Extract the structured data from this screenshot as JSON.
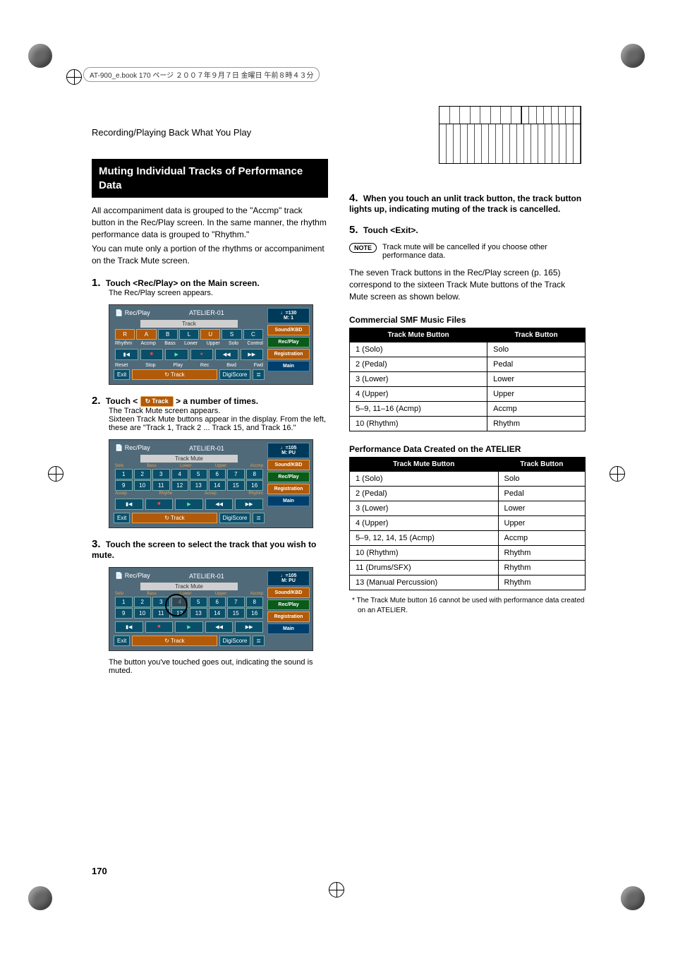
{
  "header_bar": "AT-900_e.book  170 ページ  ２００７年９月７日  金曜日  午前８時４３分",
  "running_head": "Recording/Playing Back What You Play",
  "page_number": "170",
  "section_title": "Muting Individual Tracks of Performance Data",
  "intro_p1": "All accompaniment data is grouped to the \"Accmp\" track button in the Rec/Play screen. In the same manner, the rhythm performance data is grouped to \"Rhythm.\"",
  "intro_p2": "You can mute only a portion of the rhythms or accompaniment on the Track Mute screen.",
  "step1": {
    "num": "1.",
    "instr": "Touch <Rec/Play> on the Main screen.",
    "body": "The Rec/Play screen appears."
  },
  "step2": {
    "num": "2.",
    "prefix": "Touch < ",
    "pill": "Track",
    "suffix": " > a number of times.",
    "body1": "The Track Mute screen appears.",
    "body2": "Sixteen Track Mute buttons appear in the display. From the left, these are \"Track 1, Track 2 ... Track 15, and Track 16.\""
  },
  "step3": {
    "num": "3.",
    "instr": "Touch the screen to select the track that you wish to mute.",
    "caption": "The button you've touched goes out, indicating the sound is muted."
  },
  "step4": {
    "num": "4.",
    "instr": "When you touch an unlit track button, the track button lights up, indicating muting of the track is cancelled."
  },
  "step5": {
    "num": "5.",
    "instr": "Touch <Exit>."
  },
  "note_label": "NOTE",
  "note_text": "Track mute will be cancelled if you choose other performance data.",
  "seven_tracks_p": "The seven Track buttons in the Rec/Play screen (p. 165) correspond to the sixteen Track Mute buttons of the Track Mute screen as shown below.",
  "table1_title": "Commercial SMF Music Files",
  "table_headers": {
    "mute": "Track Mute Button",
    "btn": "Track Button"
  },
  "table1_rows": [
    {
      "mute": "1 (Solo)",
      "btn": "Solo"
    },
    {
      "mute": "2 (Pedal)",
      "btn": "Pedal"
    },
    {
      "mute": "3 (Lower)",
      "btn": "Lower"
    },
    {
      "mute": "4 (Upper)",
      "btn": "Upper"
    },
    {
      "mute": "5–9, 11–16 (Acmp)",
      "btn": "Accmp"
    },
    {
      "mute": "10 (Rhythm)",
      "btn": "Rhythm"
    }
  ],
  "table2_title": "Performance Data Created on the ATELIER",
  "table2_rows": [
    {
      "mute": "1 (Solo)",
      "btn": "Solo"
    },
    {
      "mute": "2 (Pedal)",
      "btn": "Pedal"
    },
    {
      "mute": "3 (Lower)",
      "btn": "Lower"
    },
    {
      "mute": "4 (Upper)",
      "btn": "Upper"
    },
    {
      "mute": "5–9, 12, 14, 15 (Acmp)",
      "btn": "Accmp"
    },
    {
      "mute": "10 (Rhythm)",
      "btn": "Rhythm"
    },
    {
      "mute": "11 (Drums/SFX)",
      "btn": "Rhythm"
    },
    {
      "mute": "13 (Manual Percussion)",
      "btn": "Rhythm"
    }
  ],
  "footnote": "*  The Track Mute button 16 cannot be used with performance data created on an ATELIER.",
  "lcd1": {
    "title_left": "Rec/Play",
    "title_center": "ATELIER-01",
    "tempo": "♩=130",
    "meas": "M:    1",
    "section": "Track",
    "row_labels": [
      "Rhythm",
      "Accmp",
      "Bass",
      "Lower",
      "Upper",
      "",
      "Solo",
      "Control"
    ],
    "btn_letters": [
      "R",
      "A",
      "B",
      "L",
      "U",
      "S",
      "C"
    ],
    "transport": [
      "Reset",
      "Stop",
      "Play",
      "Rec",
      "Bwd",
      "Fwd"
    ],
    "side": [
      "Sound/KBD",
      "Rec/Play",
      "Registration",
      "Main"
    ],
    "footer": [
      "Exit",
      "Track",
      "DigiScore"
    ]
  },
  "lcd2": {
    "title_left": "Rec/Play",
    "title_center": "ATELIER-01",
    "tempo": "♩=105",
    "meas": "M: PU",
    "section": "Track Mute",
    "top_labels": [
      "Solo",
      "Bass",
      "Lower",
      "Upper",
      "",
      "",
      "Accmp",
      ""
    ],
    "row1": [
      "1",
      "2",
      "3",
      "4",
      "5",
      "6",
      "7",
      "8"
    ],
    "row2": [
      "9",
      "10",
      "11",
      "12",
      "13",
      "14",
      "15",
      "16"
    ],
    "bot_labels": [
      "Accep",
      "",
      "Rhythe",
      "",
      "Accep",
      "Rhythm",
      "",
      ""
    ],
    "side": [
      "Sound/KBD",
      "Rec/Play",
      "Registration",
      "Main"
    ],
    "footer": [
      "Exit",
      "Track",
      "DigiScore"
    ]
  },
  "lcd3": {
    "title_left": "Rec/Play",
    "title_center": "ATELIER-01",
    "tempo": "♩=105",
    "meas": "M: PU",
    "section": "Track Mute",
    "row1": [
      "1",
      "2",
      "3",
      "4",
      "5",
      "6",
      "7",
      "8"
    ],
    "row2": [
      "9",
      "10",
      "11",
      "12",
      "13",
      "14",
      "15",
      "16"
    ]
  }
}
